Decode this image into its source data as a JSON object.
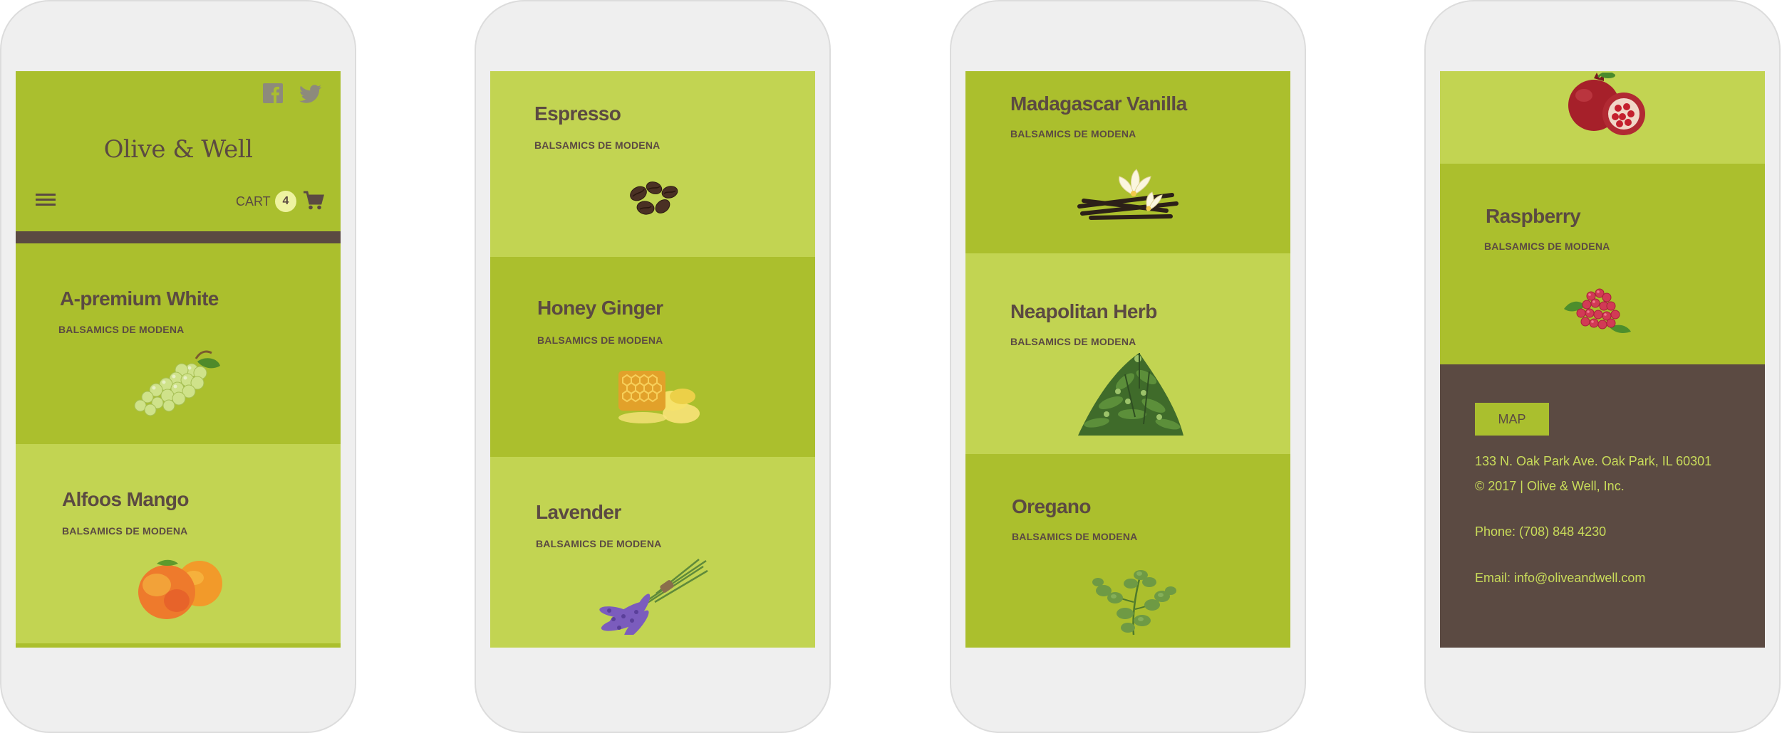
{
  "brand": {
    "logo": "Olive & Well"
  },
  "header": {
    "social": [
      "facebook-icon",
      "twitter-icon"
    ],
    "cart_label": "CART",
    "cart_count": "4"
  },
  "products": [
    {
      "name": "A-premium White",
      "subtitle": "BALSAMICS DE MODENA",
      "image": "white-grapes"
    },
    {
      "name": "Alfoos Mango",
      "subtitle": "BALSAMICS DE MODENA",
      "image": "mango"
    },
    {
      "name": "Espresso",
      "subtitle": "BALSAMICS DE MODENA",
      "image": "coffee-beans"
    },
    {
      "name": "Honey Ginger",
      "subtitle": "BALSAMICS DE MODENA",
      "image": "honeycomb-ginger"
    },
    {
      "name": "Lavender",
      "subtitle": "BALSAMICS DE MODENA",
      "image": "lavender-bunch"
    },
    {
      "name": "Madagascar Vanilla",
      "subtitle": "BALSAMICS DE MODENA",
      "image": "vanilla-pods"
    },
    {
      "name": "Neapolitan Herb",
      "subtitle": "BALSAMICS DE MODENA",
      "image": "herb-pile"
    },
    {
      "name": "Oregano",
      "subtitle": "BALSAMICS DE MODENA",
      "image": "oregano-sprig"
    },
    {
      "name": "Raspberry",
      "subtitle": "BALSAMICS DE MODENA",
      "image": "raspberries"
    }
  ],
  "partial_product_image": "pomegranate",
  "footer": {
    "map_label": "MAP",
    "address": "133 N. Oak Park Ave. Oak Park, IL 60301",
    "copyright": "© 2017 | Olive & Well, Inc.",
    "phone": "Phone: (708) 848 4230",
    "email": "Email: info@oliveandwell.com"
  },
  "colors": {
    "green_dark": "#abbf2d",
    "green_light": "#c2d452",
    "brown": "#5b4a42",
    "footer_text": "#c9dc5a",
    "badge": "#eef3a0",
    "phone_frame": "#efefef"
  }
}
